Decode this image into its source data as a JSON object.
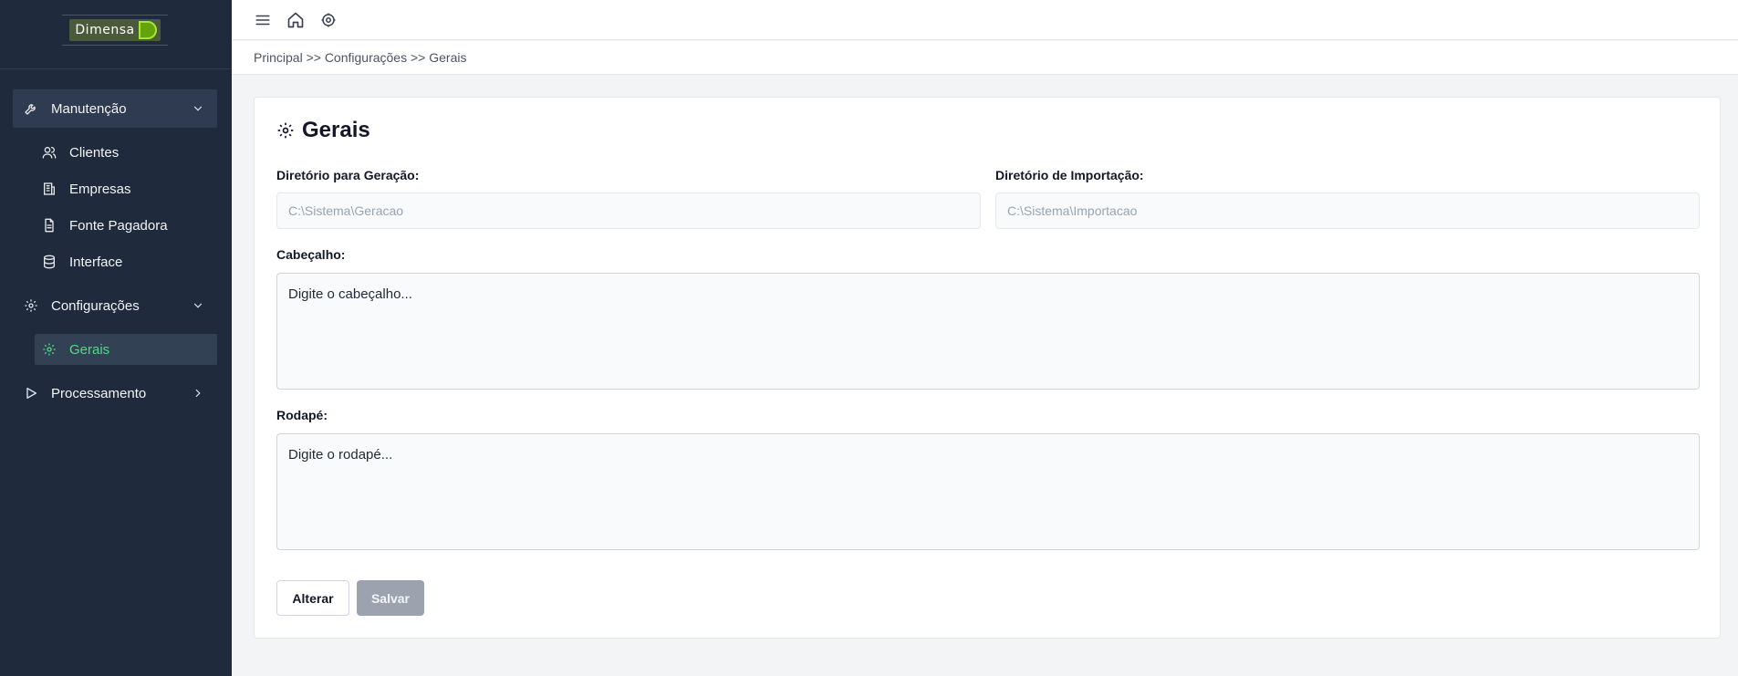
{
  "logo": {
    "text": "Dimensa"
  },
  "sidebar": {
    "groups": [
      {
        "label": "Manutenção",
        "icon": "wrench-icon",
        "expanded": true,
        "items": [
          {
            "label": "Clientes",
            "icon": "users-icon"
          },
          {
            "label": "Empresas",
            "icon": "building-icon"
          },
          {
            "label": "Fonte Pagadora",
            "icon": "document-icon"
          },
          {
            "label": "Interface",
            "icon": "database-icon"
          }
        ]
      },
      {
        "label": "Configurações",
        "icon": "gear-icon",
        "expanded": true,
        "items": [
          {
            "label": "Gerais",
            "icon": "gear-icon",
            "active": true
          }
        ]
      },
      {
        "label": "Processamento",
        "icon": "play-icon",
        "expanded": false,
        "items": []
      }
    ]
  },
  "topbar": {
    "icons": [
      "menu-icon",
      "home-icon",
      "gear-icon"
    ]
  },
  "breadcrumb": {
    "text": "Principal >> Configurações >> Gerais"
  },
  "page": {
    "title": "Gerais",
    "fields": {
      "geracao_label": "Diretório para Geração:",
      "geracao_placeholder": "C:\\Sistema\\Geracao",
      "importacao_label": "Diretório de Importação:",
      "importacao_placeholder": "C:\\Sistema\\Importacao",
      "cabecalho_label": "Cabeçalho:",
      "cabecalho_placeholder": "Digite o cabeçalho...",
      "rodape_label": "Rodapé:",
      "rodape_placeholder": "Digite o rodapé..."
    },
    "buttons": {
      "alterar": "Alterar",
      "salvar": "Salvar"
    }
  },
  "colors": {
    "sidebar_bg": "#1f2a3d",
    "active_item": "#4ade80",
    "disabled_button": "#9ca3af"
  }
}
